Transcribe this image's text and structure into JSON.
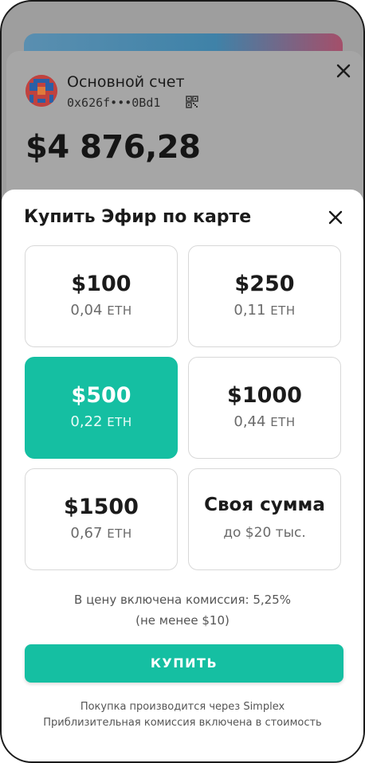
{
  "account": {
    "name": "Основной счет",
    "address": "0x626f•••0Bd1",
    "balance": "$4 876,28",
    "icons": {
      "avatar": "identicon",
      "qr": "qr-code-icon",
      "close": "close-icon"
    }
  },
  "sheet": {
    "title": "Купить Эфир по карте",
    "close_icon": "close-icon",
    "options": [
      {
        "amount": "$100",
        "eth": "0,04",
        "unit": "ETH",
        "selected": false
      },
      {
        "amount": "$250",
        "eth": "0,11",
        "unit": "ETH",
        "selected": false
      },
      {
        "amount": "$500",
        "eth": "0,22",
        "unit": "ETH",
        "selected": true
      },
      {
        "amount": "$1000",
        "eth": "0,44",
        "unit": "ETH",
        "selected": false
      },
      {
        "amount": "$1500",
        "eth": "0,67",
        "unit": "ETH",
        "selected": false
      }
    ],
    "custom": {
      "label": "Своя сумма",
      "limit": "до $20 тыс."
    },
    "fee_line1": "В цену включена комиссия: 5,25%",
    "fee_line2": "(не менее $10)",
    "buy_label": "КУПИТЬ",
    "footnote_line1": "Покупка производится через Simplex",
    "footnote_line2": "Приблизительная комиссия включена в стоимость"
  },
  "colors": {
    "accent": "#15bfa2",
    "overlay": "#a6a6a6"
  }
}
